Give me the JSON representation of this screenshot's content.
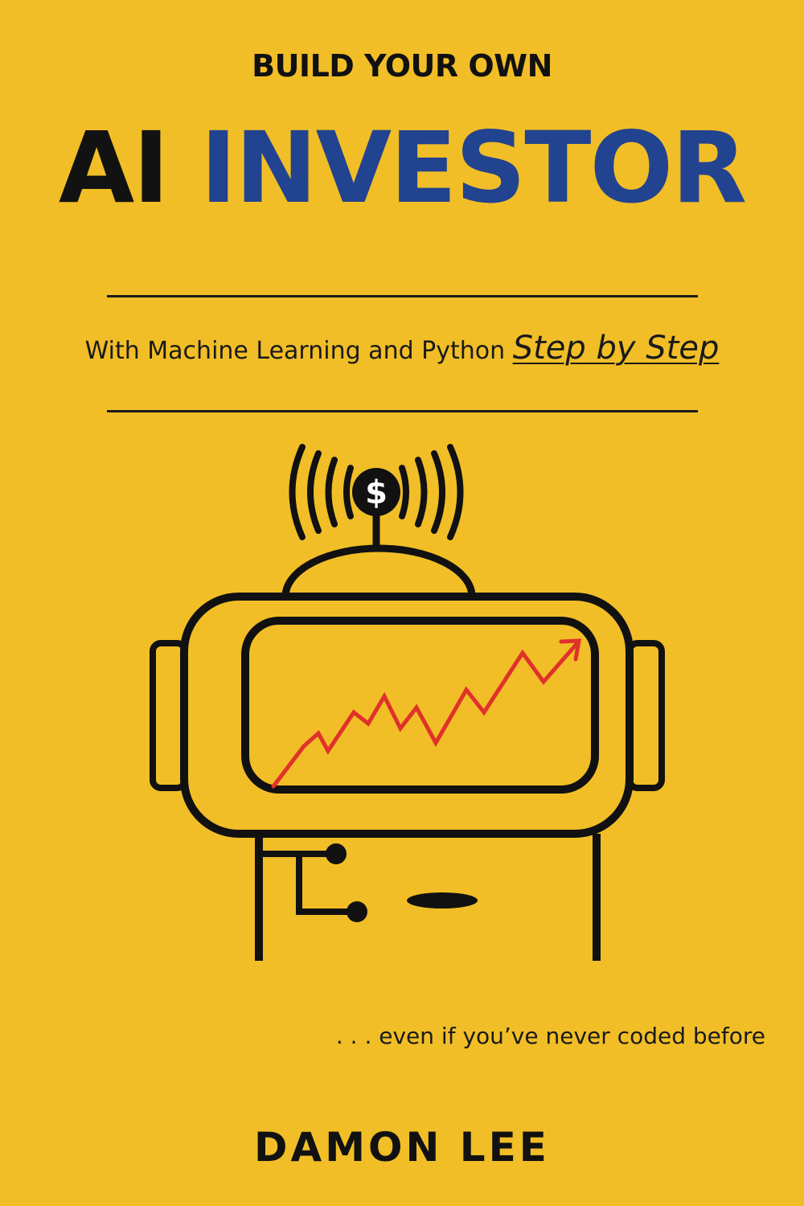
{
  "cover": {
    "pre_title": "BUILD YOUR OWN",
    "title_part1": "AI",
    "title_part2": "INVESTOR",
    "subtitle_main": "With Machine Learning and Python",
    "subtitle_emphasis": "Step by Step",
    "tagline": ". . . even if you’ve never coded before",
    "author": "DAMON LEE",
    "dollar_symbol": "$"
  },
  "colors": {
    "background": "#F1BE27",
    "title_dark": "#121212",
    "title_blue": "#22438F",
    "chart_arrow": "#E0312B"
  },
  "icons": [
    "robot-illustration-icon",
    "dollar-antenna-icon",
    "signal-waves-icon",
    "rising-arrow-icon"
  ]
}
